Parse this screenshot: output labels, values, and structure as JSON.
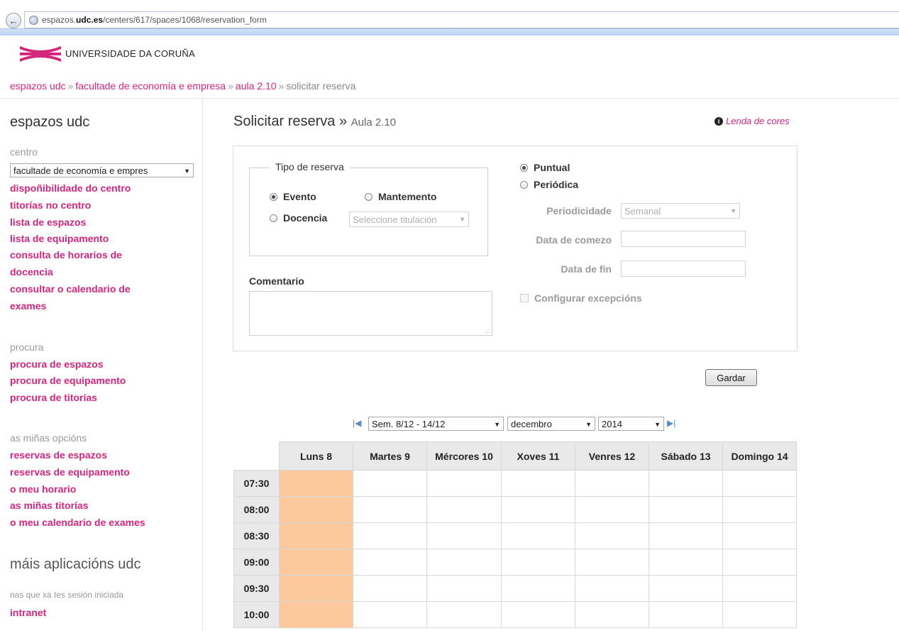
{
  "browser": {
    "url_prefix": "espazos.",
    "url_domain": "udc.es",
    "url_path": "/centers/617/spaces/1068/reservation_form"
  },
  "header": {
    "university": "UNIVERSIDADE DA CORUÑA",
    "brand_color": "#d6257d"
  },
  "breadcrumb": {
    "items": [
      "espazos udc",
      "facultade de economía e empresa",
      "aula 2.10"
    ],
    "current": "solicitar reserva",
    "separator": "»"
  },
  "sidebar": {
    "title": "espazos udc",
    "centro_label": "centro",
    "centro_value": "facultade de economía e empres",
    "centro_links": [
      "dispoñibilidade do centro",
      "titorías no centro",
      "lista de espazos",
      "lista de equipamento",
      "consulta de horarios de",
      "docencia",
      "consultar o calendario de",
      "exames"
    ],
    "procura_label": "procura",
    "procura_links": [
      "procura de espazos",
      "procura de equipamento",
      "procura de titorías"
    ],
    "opcions_label": "as miñas opcións",
    "opcions_links": [
      "reservas de espazos",
      "reservas de equipamento",
      "o meu horario",
      "as miñas titorías",
      "o meu calendario de exames"
    ],
    "mais_title": "máis aplicacións udc",
    "sesion_label": "nas que xa tes sesión iniciada",
    "intranet": "intranet"
  },
  "main": {
    "title": "Solicitar reserva",
    "separator": "»",
    "subtitle": "Aula 2.10",
    "legend_link": "Lenda de cores",
    "tipo_legend": "Tipo de reserva",
    "radio_evento": "Evento",
    "radio_mantemento": "Mantemento",
    "radio_docencia": "Docencia",
    "titulacion_placeholder": "Seleccione titulación",
    "comentario_label": "Comentario",
    "radio_puntual": "Puntual",
    "radio_periodica": "Periódica",
    "periodicidade_label": "Periodicidade",
    "periodicidade_value": "Semanal",
    "data_comezo_label": "Data de comezo",
    "data_fin_label": "Data de fin",
    "excepcions_label": "Configurar excepcións",
    "save_label": "Gardar"
  },
  "calendar": {
    "week_value": "Sem. 8/12 - 14/12",
    "month_value": "decembro",
    "year_value": "2014",
    "days": [
      "Luns 8",
      "Martes 9",
      "Mércores 10",
      "Xoves 11",
      "Venres 12",
      "Sábado 13",
      "Domingo 14"
    ],
    "times": [
      "07:30",
      "08:00",
      "08:30",
      "09:00",
      "09:30",
      "10:00"
    ],
    "highlight_color": "#fdc89b"
  }
}
